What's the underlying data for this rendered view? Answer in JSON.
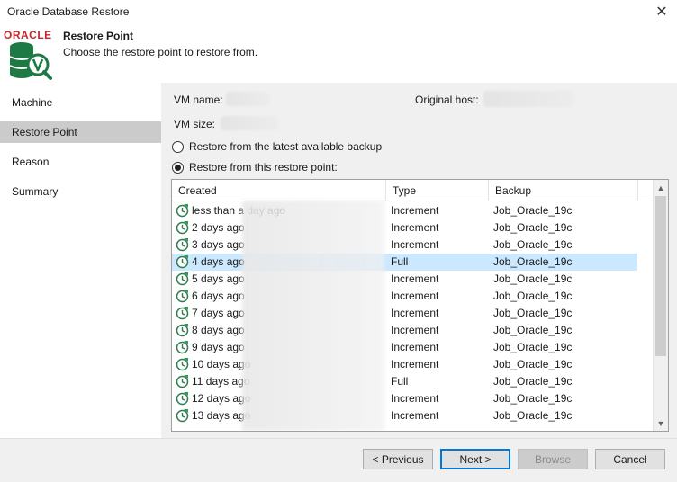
{
  "window": {
    "title": "Oracle Database Restore",
    "close_glyph": "✕"
  },
  "header": {
    "brand": "ORACLE",
    "title": "Restore Point",
    "subtitle": "Choose the restore point to restore from.",
    "icon": "database-v-icon"
  },
  "sidebar": {
    "items": [
      {
        "label": "Machine"
      },
      {
        "label": "Restore Point",
        "active": true
      },
      {
        "label": "Reason"
      },
      {
        "label": "Summary"
      }
    ]
  },
  "vm": {
    "name_label": "VM name:",
    "size_label": "VM size:",
    "original_host_label": "Original host:"
  },
  "options": {
    "latest_label": "Restore from the latest available backup",
    "point_label": "Restore from this restore point:",
    "selected": "point"
  },
  "grid": {
    "columns": [
      "Created",
      "Type",
      "Backup"
    ],
    "rows": [
      {
        "created": "less than a day ago",
        "type": "Increment",
        "backup": "Job_Oracle_19c"
      },
      {
        "created": "2 days ago",
        "type": "Increment",
        "backup": "Job_Oracle_19c"
      },
      {
        "created": "3 days ago",
        "type": "Increment",
        "backup": "Job_Oracle_19c"
      },
      {
        "created": "4 days ago",
        "type": "Full",
        "backup": "Job_Oracle_19c",
        "selected": true
      },
      {
        "created": "5 days ago",
        "type": "Increment",
        "backup": "Job_Oracle_19c"
      },
      {
        "created": "6 days ago",
        "type": "Increment",
        "backup": "Job_Oracle_19c"
      },
      {
        "created": "7 days ago",
        "type": "Increment",
        "backup": "Job_Oracle_19c"
      },
      {
        "created": "8 days ago",
        "type": "Increment",
        "backup": "Job_Oracle_19c"
      },
      {
        "created": "9 days ago",
        "type": "Increment",
        "backup": "Job_Oracle_19c"
      },
      {
        "created": "10 days ago",
        "type": "Increment",
        "backup": "Job_Oracle_19c"
      },
      {
        "created": "11 days ago",
        "type": "Full",
        "backup": "Job_Oracle_19c"
      },
      {
        "created": "12 days ago",
        "type": "Increment",
        "backup": "Job_Oracle_19c"
      },
      {
        "created": "13 days ago",
        "type": "Increment",
        "backup": "Job_Oracle_19c"
      }
    ],
    "row_icon": "restore-point-clock-icon"
  },
  "footer": {
    "previous": "< Previous",
    "next": "Next >",
    "browse": "Browse",
    "cancel": "Cancel"
  },
  "colors": {
    "selected_row": "#cce8ff",
    "oracle_red": "#c4262e",
    "icon_green": "#1e7a45",
    "sidebar_active": "#cbcbcb"
  }
}
